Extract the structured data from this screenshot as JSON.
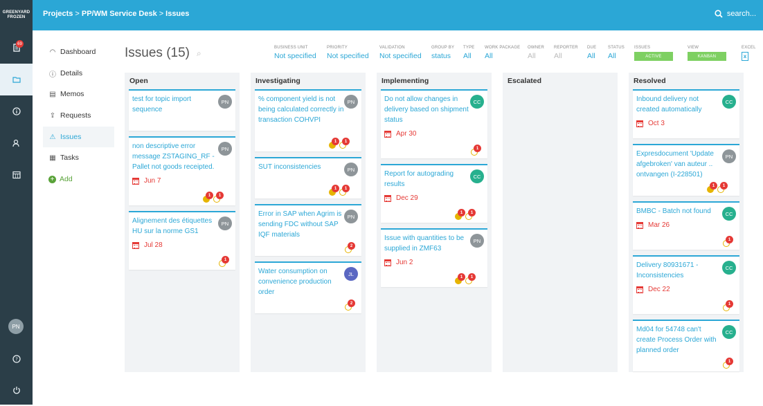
{
  "app": {
    "logo_line1": "GREENYARD",
    "logo_line2": "FROZEN"
  },
  "rail": {
    "badge": "69",
    "user_initials": "PN"
  },
  "breadcrumb": {
    "projects": "Projects",
    "sep1": ">",
    "project": "PP/WM Service Desk",
    "sep2": ">",
    "current": "Issues"
  },
  "search": {
    "placeholder": "search..."
  },
  "nav": {
    "items": [
      {
        "label": "Dashboard",
        "icon": "gauge-icon"
      },
      {
        "label": "Details",
        "icon": "info-icon"
      },
      {
        "label": "Memos",
        "icon": "memo-icon"
      },
      {
        "label": "Requests",
        "icon": "request-icon"
      },
      {
        "label": "Issues",
        "icon": "warning-icon"
      },
      {
        "label": "Tasks",
        "icon": "clipboard-icon"
      },
      {
        "label": "Add",
        "icon": "plus-icon"
      }
    ]
  },
  "page": {
    "title": "Issues",
    "count": "(15)"
  },
  "filters": {
    "business_unit": {
      "label": "BUSINESS UNIT",
      "value": "Not specified"
    },
    "priority": {
      "label": "PRIORITY",
      "value": "Not specified"
    },
    "validation": {
      "label": "VALIDATION",
      "value": "Not specified"
    },
    "group_by": {
      "label": "GROUP BY",
      "value": "status"
    },
    "type": {
      "label": "TYPE",
      "value": "All"
    },
    "work_package": {
      "label": "WORK PACKAGE",
      "value": "All"
    },
    "owner": {
      "label": "OWNER",
      "value": "All"
    },
    "reporter": {
      "label": "REPORTER",
      "value": "All"
    },
    "due": {
      "label": "DUE",
      "value": "All"
    },
    "status": {
      "label": "STATUS",
      "value": "All"
    },
    "issues": {
      "label": "ISSUES",
      "value": "ACTIVE"
    },
    "view": {
      "label": "VIEW",
      "value": "KANBAN"
    },
    "excel": {
      "label": "EXCEL"
    }
  },
  "columns": [
    {
      "name": "Open",
      "cards": [
        {
          "title": "test for topic import sequence",
          "owner": "PN",
          "due": "",
          "badges": []
        },
        {
          "title": "non descriptive error message ZSTAGING_RF - Pallet not goods receipted.",
          "owner": "PN",
          "due": "Jun 7",
          "badges": [
            "1",
            "1"
          ]
        },
        {
          "title": "Alignement des étiquettes HU sur la norme GS1",
          "owner": "PN",
          "due": "Jul 28",
          "badges": [
            "1"
          ]
        }
      ]
    },
    {
      "name": "Investigating",
      "cards": [
        {
          "title": "% component yield is not being calculated correctly in transaction COHVPI",
          "owner": "PN",
          "due": "",
          "badges": [
            "1",
            "1"
          ]
        },
        {
          "title": "SUT inconsistencies",
          "owner": "PN",
          "due": "",
          "badges": [
            "1",
            "1"
          ]
        },
        {
          "title": "Error in SAP when Agrim is sending FDC without SAP IQF materials",
          "owner": "PN",
          "due": "",
          "badges": [
            "2"
          ]
        },
        {
          "title": "Water consumption on convenience production order",
          "owner": "JL",
          "due": "",
          "badges": [
            "2"
          ]
        }
      ]
    },
    {
      "name": "Implementing",
      "cards": [
        {
          "title": "Do not allow changes in delivery based on shipment status",
          "owner": "CC",
          "due": "Apr 30",
          "badges": [
            "1"
          ]
        },
        {
          "title": "Report for autograding results",
          "owner": "CC",
          "due": "Dec 29",
          "badges": [
            "1",
            "1"
          ]
        },
        {
          "title": "Issue with quantities to be supplied in ZMF63",
          "owner": "PN",
          "due": "Jun 2",
          "badges": [
            "1",
            "1"
          ]
        }
      ]
    },
    {
      "name": "Escalated",
      "cards": []
    },
    {
      "name": "Resolved",
      "cards": [
        {
          "title": "Inbound delivery not created automatically",
          "owner": "CC",
          "due": "Oct 3",
          "badges": []
        },
        {
          "title": "Expresdocument 'Update afgebroken' van auteur .. ontvangen (I-228501)",
          "owner": "PN",
          "due": "",
          "badges": [
            "1",
            "1"
          ]
        },
        {
          "title": "BMBC - Batch not found",
          "owner": "CC",
          "due": "Mar 26",
          "badges": [
            "1"
          ]
        },
        {
          "title": "Delivery 80931671 - Inconsistencies",
          "owner": "CC",
          "due": "Dec 22",
          "badges": [
            "1"
          ]
        },
        {
          "title": "Md04 for 54748 can't create Process Order with planned order",
          "owner": "CC",
          "due": "",
          "badges": [
            "1"
          ]
        }
      ]
    }
  ],
  "colors": {
    "accent": "#2ba7d6",
    "rail": "#2b3e48",
    "due": "#e53935",
    "badge": "#e53935",
    "pill": "#7ed062"
  }
}
